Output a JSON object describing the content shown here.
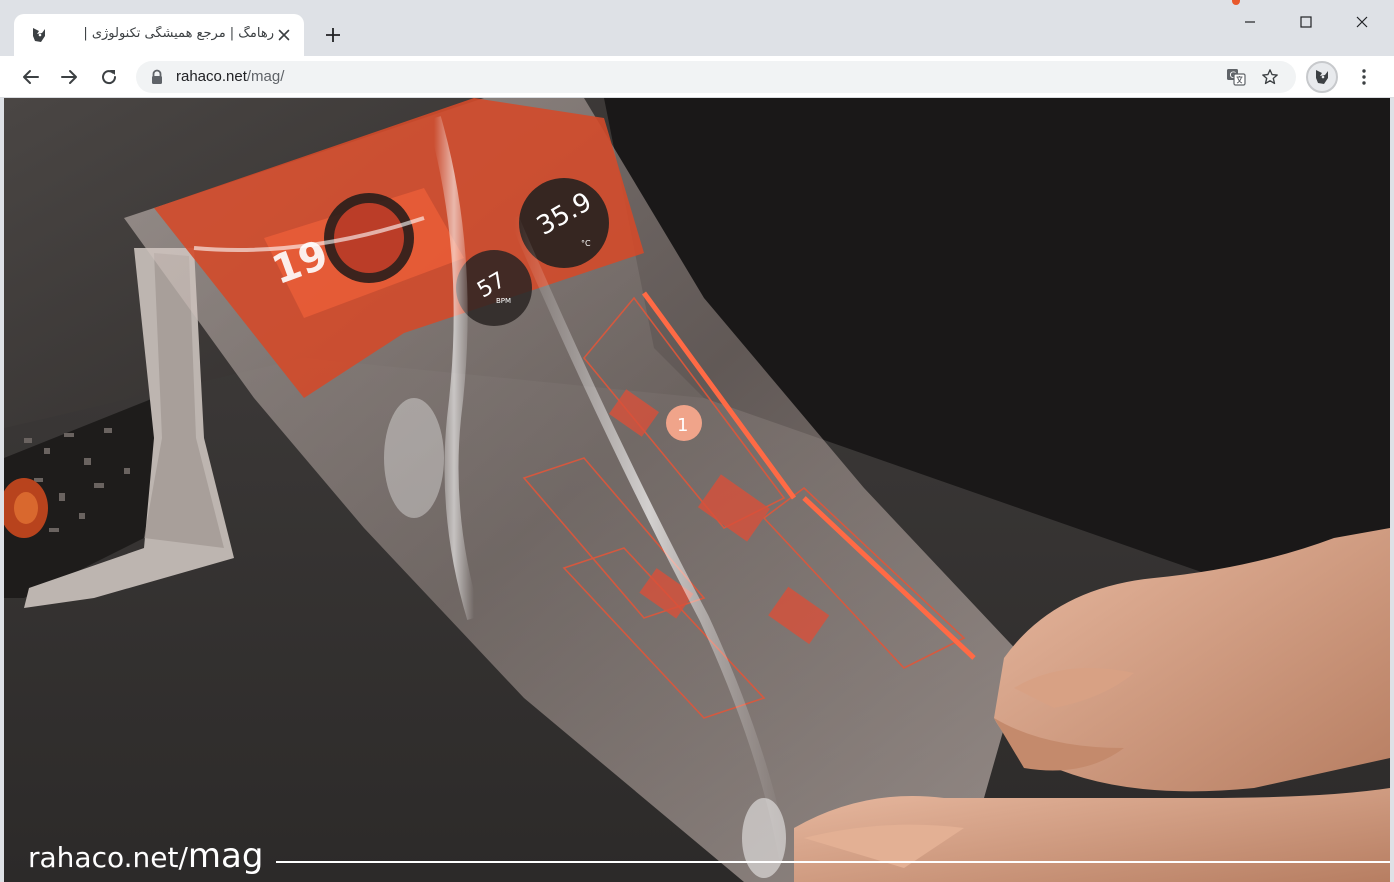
{
  "browser": {
    "tab": {
      "title": "رهامگ | مرجع همیشگی تکنولوژی |",
      "close_icon": "close-icon",
      "favicon": "rahaco-logo"
    },
    "new_tab_icon": "plus-icon",
    "window_controls": [
      "minimize-icon",
      "maximize-icon",
      "close-icon"
    ],
    "toolbar": {
      "back_icon": "arrow-left-icon",
      "forward_icon": "arrow-right-icon",
      "reload_icon": "reload-icon",
      "url_host": "rahaco.net",
      "url_path": "/mag/",
      "lock_icon": "lock-icon",
      "translate_icon": "translate-icon",
      "bookmark_icon": "star-icon",
      "profile_icon": "rahaco-logo",
      "menu_icon": "kebab-menu-icon"
    },
    "accent_color": "#e8592d"
  },
  "page": {
    "hero_image": "person holding a flexible transparent display showing orange-red UI",
    "display_readouts": {
      "temperature": "35.9",
      "temperature_unit": "°C",
      "bpm": "57",
      "bpm_unit": "BPM",
      "big_number": "19",
      "marker": "1"
    },
    "watermark": {
      "host": "rahaco.net/",
      "path": "mag"
    }
  }
}
